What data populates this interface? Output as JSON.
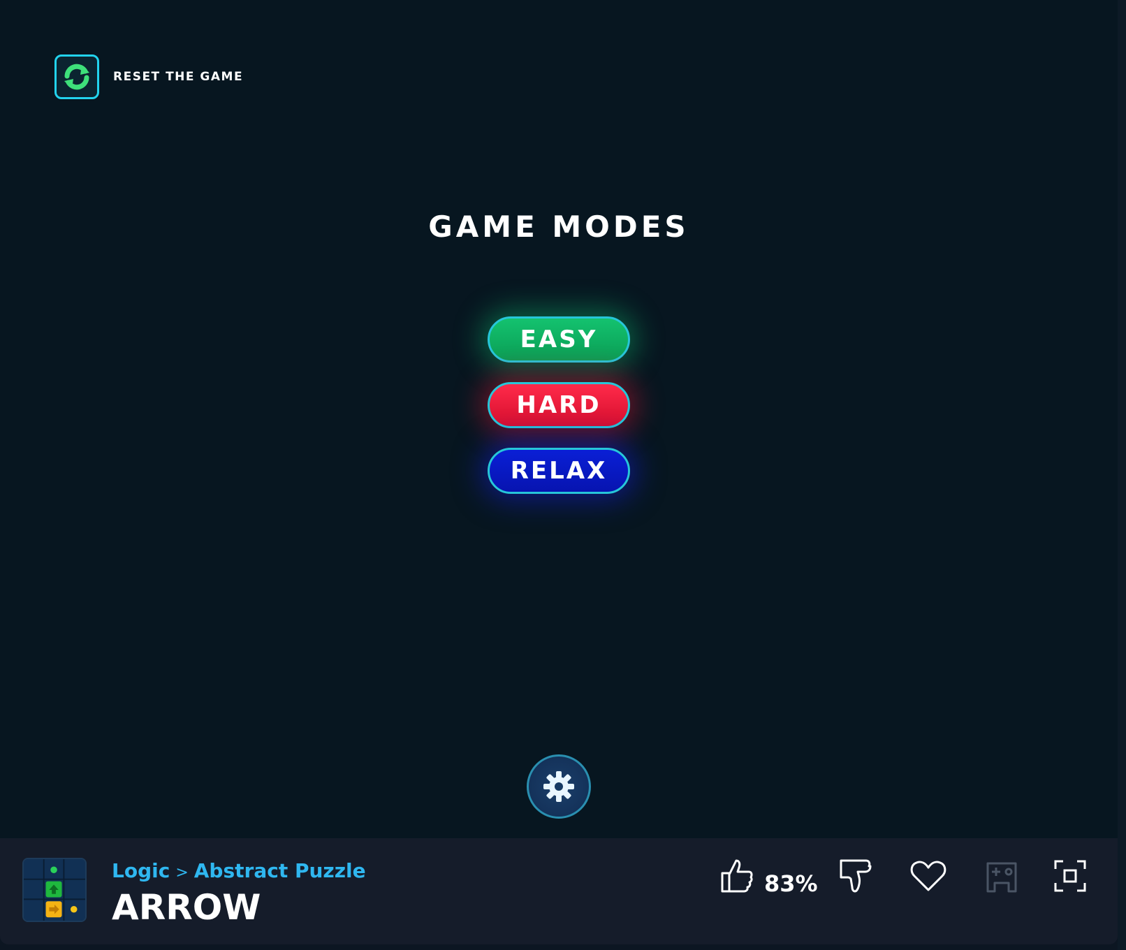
{
  "reset": {
    "label": "RESET THE GAME"
  },
  "title": "GAME MODES",
  "modes": [
    {
      "label": "EASY",
      "color": "#10b96c"
    },
    {
      "label": "HARD",
      "color": "#e8163a"
    },
    {
      "label": "RELAX",
      "color": "#0a1bd0"
    }
  ],
  "settings": {
    "icon": "gear-icon"
  },
  "footer": {
    "category": "Logic",
    "separator": ">",
    "subcategory": "Abstract Puzzle",
    "game_title": "ARROW",
    "like_percent": "83%",
    "icons": [
      "thumbs-up-icon",
      "thumbs-down-icon",
      "heart-icon",
      "gamepad-icon",
      "fullscreen-icon"
    ]
  },
  "colors": {
    "background": "#071620",
    "footer_bg": "#151c2a",
    "accent_cyan": "#22d3ee",
    "link_blue": "#2fb7f0"
  }
}
